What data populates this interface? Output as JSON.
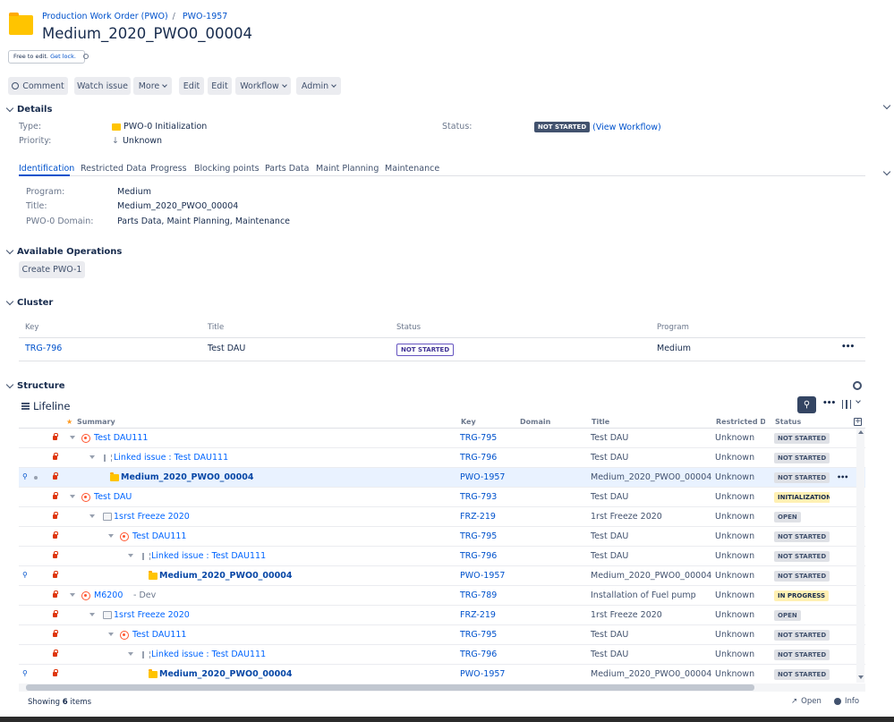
{
  "breadcrumb": {
    "project": "Production Work Order (PWO)",
    "separator": "/",
    "issue_key": "PWO-1957"
  },
  "page_title": "Medium_2020_PWO0_00004",
  "lock_notice": {
    "text": "Free to edit.",
    "link": "Get lock."
  },
  "toolbar": {
    "comment": "Comment",
    "watch": "Watch issue",
    "more": "More",
    "edit1": "Edit",
    "edit2": "Edit",
    "workflow": "Workflow",
    "admin": "Admin"
  },
  "details": {
    "heading": "Details",
    "type_label": "Type:",
    "type_value": "PWO-0 Initialization",
    "priority_label": "Priority:",
    "priority_value": "Unknown",
    "status_label": "Status:",
    "status_value": "NOT STARTED",
    "view_workflow": "(View Workflow)"
  },
  "tabs": [
    "Identification",
    "Restricted Data",
    "Progress",
    "Blocking points",
    "Parts Data",
    "Maint Planning",
    "Maintenance"
  ],
  "identification": {
    "program_label": "Program:",
    "program_value": "Medium",
    "title_label": "Title:",
    "title_value": "Medium_2020_PWO0_00004",
    "domain_label": "PWO-0 Domain:",
    "domain_value": "Parts Data, Maint Planning, Maintenance"
  },
  "operations": {
    "heading": "Available Operations",
    "create_button": "Create PWO-1"
  },
  "cluster": {
    "heading": "Cluster",
    "columns": [
      "Key",
      "Title",
      "Status",
      "Program"
    ],
    "row": {
      "key": "TRG-796",
      "title": "Test DAU",
      "status": "NOT STARTED",
      "program": "Medium",
      "more": "•••"
    }
  },
  "structure": {
    "heading": "Structure",
    "view_name": "Lifeline",
    "columns": {
      "summary": "Summary",
      "key": "Key",
      "domain": "Domain",
      "title": "Title",
      "restricted": "Restricted Data",
      "status": "Status"
    },
    "rows": [
      {
        "summary": "Test DAU111",
        "key": "TRG-795",
        "title": "Test DAU",
        "restricted": "Unknown",
        "status": "NOT STARTED"
      },
      {
        "summary": "Linked issue : Test DAU111",
        "key": "TRG-796",
        "title": "Test DAU",
        "restricted": "Unknown",
        "status": "NOT STARTED"
      },
      {
        "summary": "Medium_2020_PWO0_00004",
        "key": "PWO-1957",
        "title": "Medium_2020_PWO0_00004",
        "restricted": "Unknown",
        "status": "NOT STARTED",
        "more": "•••"
      },
      {
        "summary": "Test DAU",
        "key": "TRG-793",
        "title": "Test DAU",
        "restricted": "Unknown",
        "status": "INITIALIZATION"
      },
      {
        "summary": "1srst Freeze 2020",
        "key": "FRZ-219",
        "title": "1rst Freeze 2020",
        "restricted": "Unknown",
        "status": "OPEN"
      },
      {
        "summary": "Test DAU111",
        "key": "TRG-795",
        "title": "Test DAU",
        "restricted": "Unknown",
        "status": "NOT STARTED"
      },
      {
        "summary": "Linked issue : Test DAU111",
        "key": "TRG-796",
        "title": "Test DAU",
        "restricted": "Unknown",
        "status": "NOT STARTED"
      },
      {
        "summary": "Medium_2020_PWO0_00004",
        "key": "PWO-1957",
        "title": "Medium_2020_PWO0_00004",
        "restricted": "Unknown",
        "status": "NOT STARTED"
      },
      {
        "summary": "M6200",
        "suffix": "Dev",
        "key": "TRG-789",
        "title": "Installation of Fuel pump",
        "restricted": "Unknown",
        "status": "IN PROGRESS"
      },
      {
        "summary": "1srst Freeze 2020",
        "key": "FRZ-219",
        "title": "1rst Freeze 2020",
        "restricted": "Unknown",
        "status": "OPEN"
      },
      {
        "summary": "Test DAU111",
        "key": "TRG-795",
        "title": "Test DAU",
        "restricted": "Unknown",
        "status": "NOT STARTED"
      },
      {
        "summary": "Linked issue : Test DAU111",
        "key": "TRG-796",
        "title": "Test DAU",
        "restricted": "Unknown",
        "status": "NOT STARTED"
      },
      {
        "summary": "Medium_2020_PWO0_00004",
        "key": "PWO-1957",
        "title": "Medium_2020_PWO0_00004",
        "restricted": "Unknown",
        "status": "NOT STARTED"
      }
    ],
    "footer": {
      "prefix": "Showing",
      "count": "6",
      "suffix": "items",
      "open": "Open",
      "info": "Info"
    }
  }
}
